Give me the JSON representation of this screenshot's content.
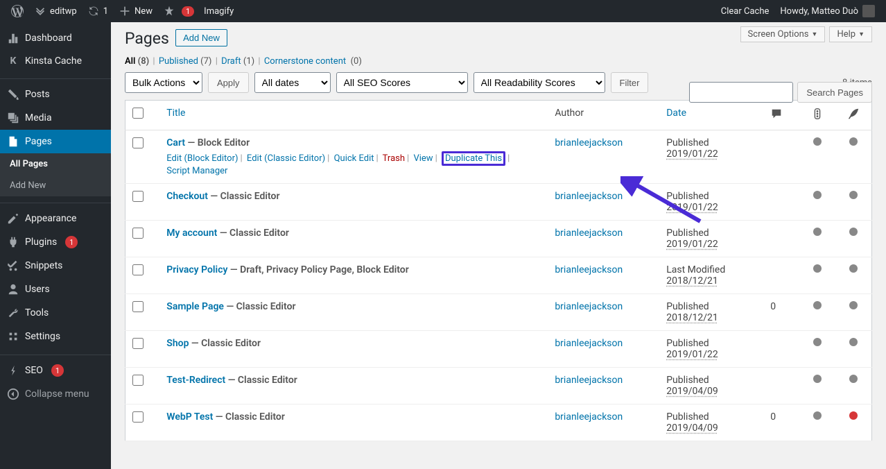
{
  "admin_bar": {
    "site_name": "editwp",
    "refresh_count": "1",
    "new_label": "New",
    "imagify_label": "Imagify",
    "imagify_badge": "1",
    "clear_cache": "Clear Cache",
    "howdy": "Howdy, Matteo Duò"
  },
  "sidebar": {
    "dashboard": "Dashboard",
    "kinsta": "Kinsta Cache",
    "posts": "Posts",
    "media": "Media",
    "pages": "Pages",
    "pages_sub": {
      "all": "All Pages",
      "add": "Add New"
    },
    "appearance": "Appearance",
    "plugins": "Plugins",
    "plugins_count": "1",
    "snippets": "Snippets",
    "users": "Users",
    "tools": "Tools",
    "settings": "Settings",
    "seo": "SEO",
    "seo_count": "1",
    "collapse": "Collapse menu"
  },
  "screen": {
    "options": "Screen Options",
    "help": "Help"
  },
  "heading": {
    "title": "Pages",
    "add_new": "Add New"
  },
  "views": {
    "all_label": "All",
    "all_count": "(8)",
    "published_label": "Published",
    "published_count": "(7)",
    "draft_label": "Draft",
    "draft_count": "(1)",
    "cornerstone_label": "Cornerstone content",
    "cornerstone_count": "(0)"
  },
  "filters": {
    "bulk": "Bulk Actions",
    "apply": "Apply",
    "dates": "All dates",
    "seo": "All SEO Scores",
    "readability": "All Readability Scores",
    "filter": "Filter",
    "items_count": "8 items",
    "search_btn": "Search Pages"
  },
  "columns": {
    "title": "Title",
    "author": "Author",
    "date": "Date"
  },
  "row_actions": {
    "edit_block": "Edit (Block Editor)",
    "edit_classic": "Edit (Classic Editor)",
    "quick_edit": "Quick Edit",
    "trash": "Trash",
    "view": "View",
    "duplicate": "Duplicate This",
    "script_mgr": "Script Manager"
  },
  "rows": [
    {
      "title": "Cart",
      "state": " — Block Editor",
      "author": "brianleejackson",
      "date_label": "Published",
      "date": "2019/01/22",
      "comments": "",
      "dot1": "grey",
      "dot2": "grey",
      "show_actions": true
    },
    {
      "title": "Checkout",
      "state": " — Classic Editor",
      "author": "brianleejackson",
      "date_label": "Published",
      "date": "2019/01/22",
      "comments": "",
      "dot1": "grey",
      "dot2": "grey"
    },
    {
      "title": "My account",
      "state": " — Classic Editor",
      "author": "brianleejackson",
      "date_label": "Published",
      "date": "2019/01/22",
      "comments": "",
      "dot1": "grey",
      "dot2": "grey"
    },
    {
      "title": "Privacy Policy",
      "state": " — Draft, Privacy Policy Page, Block Editor",
      "author": "brianleejackson",
      "date_label": "Last Modified",
      "date": "2018/12/21",
      "comments": "",
      "dot1": "grey",
      "dot2": "grey"
    },
    {
      "title": "Sample Page",
      "state": " — Classic Editor",
      "author": "brianleejackson",
      "date_label": "Published",
      "date": "2018/12/21",
      "comments": "0",
      "dot1": "grey",
      "dot2": "grey"
    },
    {
      "title": "Shop",
      "state": " — Classic Editor",
      "author": "brianleejackson",
      "date_label": "Published",
      "date": "2019/01/22",
      "comments": "",
      "dot1": "grey",
      "dot2": "grey"
    },
    {
      "title": "Test-Redirect",
      "state": " — Classic Editor",
      "author": "brianleejackson",
      "date_label": "Published",
      "date": "2019/04/09",
      "comments": "",
      "dot1": "grey",
      "dot2": "grey"
    },
    {
      "title": "WebP Test",
      "state": " — Classic Editor",
      "author": "brianleejackson",
      "date_label": "Published",
      "date": "2019/04/09",
      "comments": "0",
      "dot1": "grey",
      "dot2": "red"
    }
  ]
}
